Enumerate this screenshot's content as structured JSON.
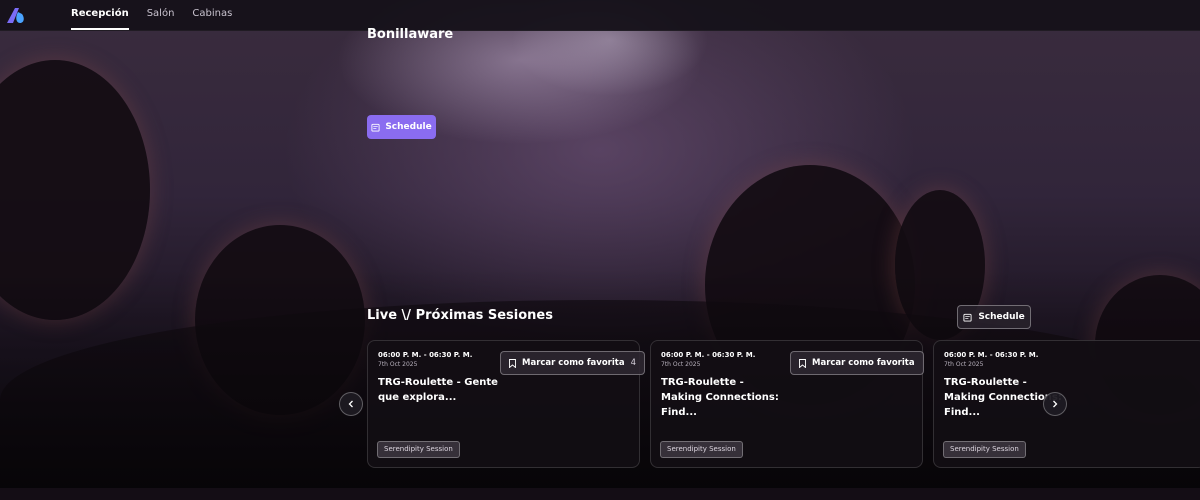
{
  "nav": {
    "tabs": [
      {
        "label": "Recepción",
        "active": true
      },
      {
        "label": "Salón",
        "active": false
      },
      {
        "label": "Cabinas",
        "active": false
      }
    ]
  },
  "hero": {
    "event_name": "Bonillaware",
    "schedule_label": "Schedule"
  },
  "sessions": {
    "title": "Live \\/ Próximas Sesiones",
    "schedule_label": "Schedule",
    "cards": [
      {
        "time": "06:00 P. M. - 06:30 P. M.",
        "date": "7th Oct 2025",
        "title": "TRG-Roulette - Gente que explora...",
        "favorite_label": "Marcar como favorita",
        "favorite_count": "4",
        "tag": "Serendipity Session"
      },
      {
        "time": "06:00 P. M. - 06:30 P. M.",
        "date": "7th Oct 2025",
        "title": "TRG-Roulette - Making Connections: Find...",
        "favorite_label": "Marcar como favorita",
        "favorite_count": "",
        "tag": "Serendipity Session"
      },
      {
        "time": "06:00 P. M. - 06:30 P. M.",
        "date": "7th Oct 2025",
        "title": "TRG-Roulette - Making Connections: Find...",
        "tag": "Serendipity Session"
      }
    ]
  },
  "colors": {
    "accent": "#8a6cf0",
    "logo_top": "#7b6cf6",
    "logo_drop": "#4aa3ff"
  },
  "icons": {
    "logo": "logo-icon",
    "calendar": "calendar-icon",
    "bookmark": "bookmark-icon",
    "prev": "chevron-left-icon",
    "next": "chevron-right-icon"
  }
}
